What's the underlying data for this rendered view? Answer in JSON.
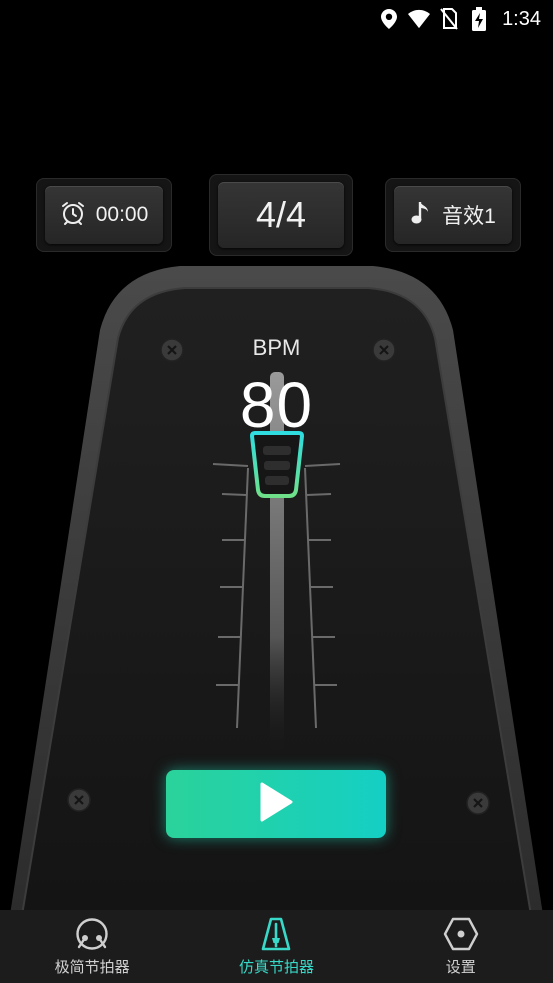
{
  "status_bar": {
    "time": "1:34",
    "icons": [
      "location-icon",
      "wifi-icon",
      "no-sim-icon",
      "battery-charging-icon"
    ]
  },
  "controls": {
    "timer": {
      "icon": "alarm-clock-icon",
      "label": "00:00"
    },
    "time_signature": {
      "label": "4/4"
    },
    "sound": {
      "icon": "music-note-icon",
      "label": "音效1"
    }
  },
  "metronome": {
    "bpm_label": "BPM",
    "bpm_value": "80",
    "play_icon": "play-icon"
  },
  "nav": {
    "items": [
      {
        "label": "极简节拍器",
        "icon": "drum-icon",
        "active": false
      },
      {
        "label": "仿真节拍器",
        "icon": "metronome-icon",
        "active": true
      },
      {
        "label": "设置",
        "icon": "hexagon-settings-icon",
        "active": false
      }
    ]
  },
  "colors": {
    "accent": "#38d9c8",
    "play_gradient_start": "#2bd39a",
    "play_gradient_end": "#14cfc4"
  }
}
